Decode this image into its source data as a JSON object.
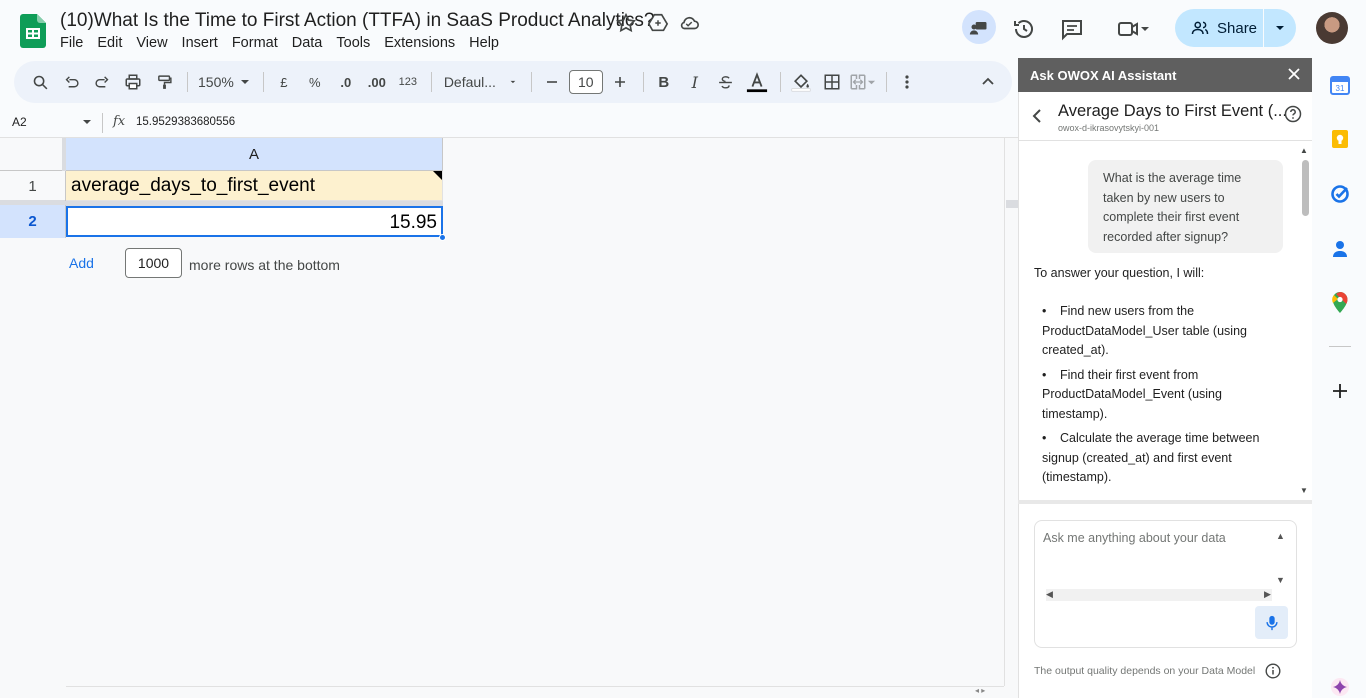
{
  "doc": {
    "title": "(10)What Is the Time to First Action (TTFA) in SaaS Product Analytics?",
    "menu": [
      "File",
      "Edit",
      "View",
      "Insert",
      "Format",
      "Data",
      "Tools",
      "Extensions",
      "Help"
    ]
  },
  "header": {
    "share_label": "Share"
  },
  "toolbar": {
    "zoom": "150%",
    "currency": "£",
    "percent": "%",
    "dec_decrease": ".0",
    "dec_increase": ".00",
    "number_format": "123",
    "font": "Defaul...",
    "font_size": "10",
    "bold": "B",
    "italic": "I"
  },
  "formula_bar": {
    "cell_ref": "A2",
    "fx": "fx",
    "value": "15.9529383680556"
  },
  "sheet": {
    "column_header": "A",
    "row_headers": [
      "1",
      "2"
    ],
    "cells": {
      "a1": "average_days_to_first_event",
      "a2": "15.95"
    },
    "add_rows": {
      "link": "Add",
      "count": "1000",
      "suffix": "more rows at the bottom"
    }
  },
  "panel": {
    "header": "Ask OWOX AI Assistant",
    "chat_title": "Average Days to First Event (...",
    "chat_subtitle": "owox-d-ikrasovytskyi-001",
    "user_message": "What is the average time taken by new users to complete their first event recorded after signup?",
    "assistant_intro": "To answer your question, I will:",
    "assistant_steps": [
      "Find new users from the ProductDataModel_User table (using created_at).",
      "Find their first event from ProductDataModel_Event (using timestamp).",
      "Calculate the average time between signup (created_at) and first event (timestamp)."
    ],
    "input_placeholder": "Ask me anything about your data",
    "footer_note": "The output quality depends on your Data Model"
  },
  "colors": {
    "accent": "#1a73e8",
    "share_bg": "#c2e7ff",
    "header_fill": "#d3e3fd",
    "a1_fill": "#fdf1cf",
    "panel_header": "#5f5f5f"
  }
}
